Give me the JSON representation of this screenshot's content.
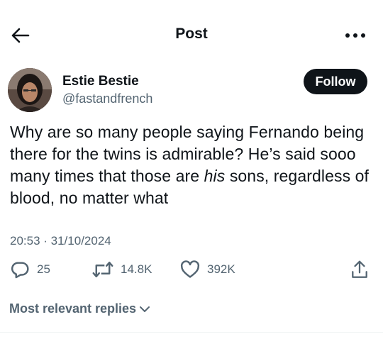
{
  "header": {
    "title": "Post",
    "back_icon": "arrow-left-icon",
    "more_icon": "more-horizontal-icon"
  },
  "author": {
    "display_name": "Estie Bestie",
    "handle": "@fastandfrench",
    "follow_label": "Follow"
  },
  "post": {
    "text_before": "Why are so many people saying Fernando being there for the twins is admirable? He’s said sooo many times that those are ",
    "text_italic": "his",
    "text_after": " sons, regardless of blood, no matter what",
    "timestamp": "20:53 · 31/10/2024"
  },
  "actions": {
    "replies": "25",
    "reposts": "14.8K",
    "likes": "392K",
    "icons": [
      "reply-icon",
      "repost-icon",
      "like-icon",
      "share-icon"
    ]
  },
  "replies_sort": {
    "label": "Most relevant replies"
  },
  "colors": {
    "text": "#0f1419",
    "muted": "#536471",
    "follow_bg": "#0f1419",
    "divider": "#eff3f4"
  }
}
